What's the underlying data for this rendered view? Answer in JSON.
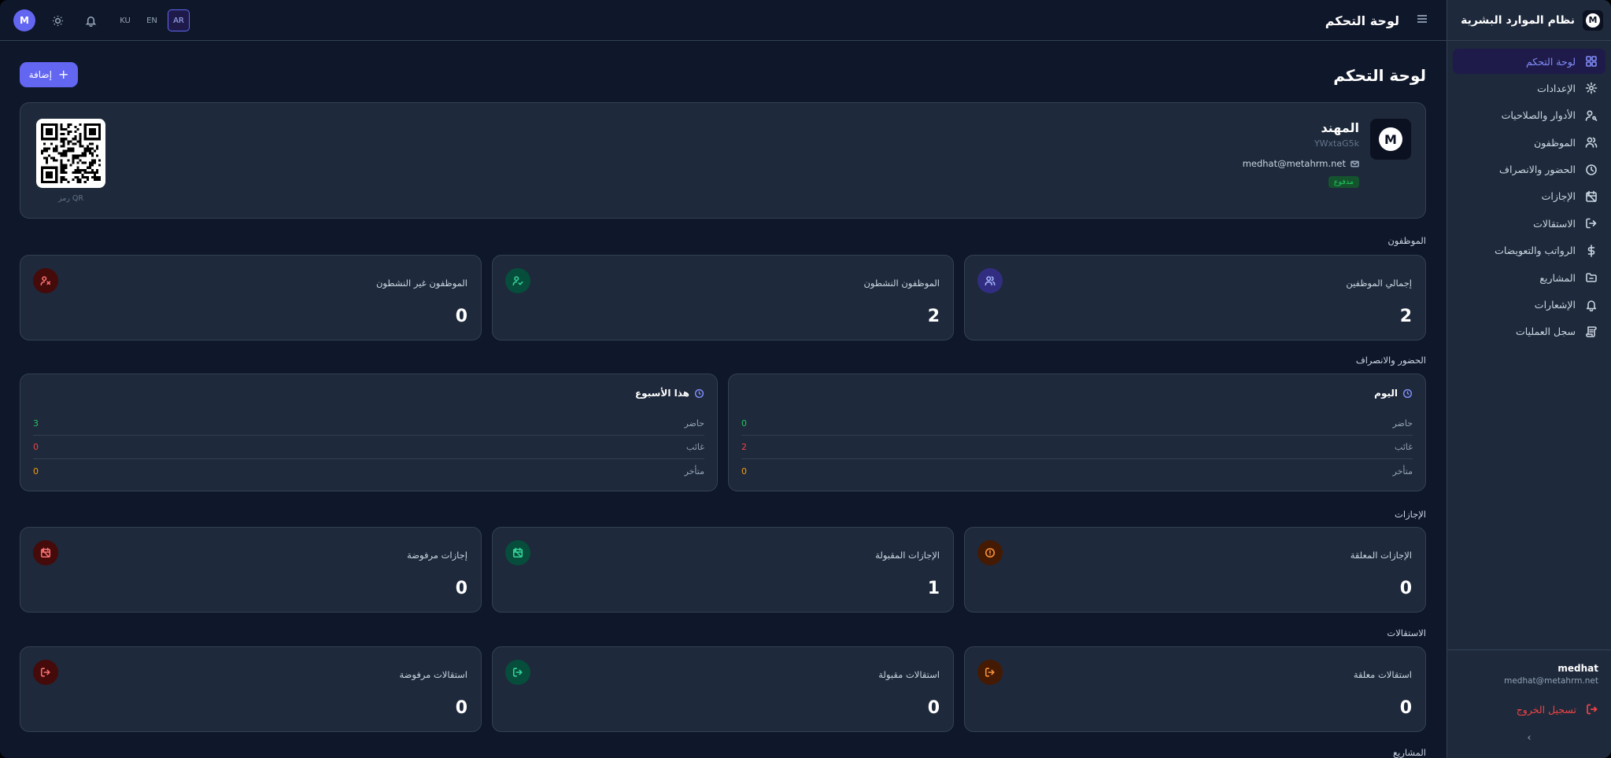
{
  "sidebar": {
    "title": "نظام الموارد البشرية",
    "logo_letter": "M",
    "items": [
      {
        "label": "لوحة التحكم",
        "active": true
      },
      {
        "label": "الإعدادات"
      },
      {
        "label": "الأدوار والصلاحيات"
      },
      {
        "label": "الموظفون"
      },
      {
        "label": "الحضور والانصراف"
      },
      {
        "label": "الإجازات"
      },
      {
        "label": "الاستقالات"
      },
      {
        "label": "الرواتب والتعويضات"
      },
      {
        "label": "المشاريع"
      },
      {
        "label": "الإشعارات"
      },
      {
        "label": "سجل العمليات"
      }
    ],
    "user_name": "medhat",
    "user_email": "medhat@metahrm.net",
    "logout_label": "تسجيل الخروج",
    "collapse_icon": "‹"
  },
  "topbar": {
    "title": "لوحة التحكم",
    "avatar_letter": "M",
    "languages": [
      "KU",
      "EN",
      "AR"
    ],
    "active_language": "AR"
  },
  "main": {
    "page_title": "لوحة التحكم",
    "add_label": "إضافة",
    "profile": {
      "logo_letter": "M",
      "name": "المهند",
      "code": "YWxtaG5k",
      "email": "medhat@metahrm.net",
      "badge": "مدفوع",
      "qr_label": "رمز QR"
    },
    "employees": {
      "section_title": "الموظفون",
      "cards": [
        {
          "label": "إجمالي الموظفين",
          "value": "2"
        },
        {
          "label": "الموظفون النشطون",
          "value": "2"
        },
        {
          "label": "الموظفون غير النشطون",
          "value": "0"
        }
      ]
    },
    "attendance": {
      "section_title": "الحضور والانصراف",
      "today": {
        "title": "اليوم",
        "rows": [
          {
            "label": "حاضر",
            "value": "0"
          },
          {
            "label": "غائب",
            "value": "2"
          },
          {
            "label": "متأخر",
            "value": "0"
          }
        ]
      },
      "week": {
        "title": "هذا الأسبوع",
        "rows": [
          {
            "label": "حاضر",
            "value": "3"
          },
          {
            "label": "غائب",
            "value": "0"
          },
          {
            "label": "متأخر",
            "value": "0"
          }
        ]
      }
    },
    "leaves": {
      "section_title": "الإجازات",
      "cards": [
        {
          "label": "الإجازات المعلقة",
          "value": "0"
        },
        {
          "label": "الإجازات المقبولة",
          "value": "1"
        },
        {
          "label": "إجازات مرفوضة",
          "value": "0"
        }
      ]
    },
    "resignations": {
      "section_title": "الاستقالات",
      "cards": [
        {
          "label": "استقالات معلقة",
          "value": "0"
        },
        {
          "label": "استقالات مقبولة",
          "value": "0"
        },
        {
          "label": "استقالات مرفوضة",
          "value": "0"
        }
      ]
    },
    "projects": {
      "section_title": "المشاريع"
    }
  },
  "colors": {
    "accent": "#6366f1",
    "background": "#0f172a",
    "card": "#1e293b",
    "success": "#22c55e",
    "danger": "#ef4444",
    "warning": "#f59e0b"
  }
}
